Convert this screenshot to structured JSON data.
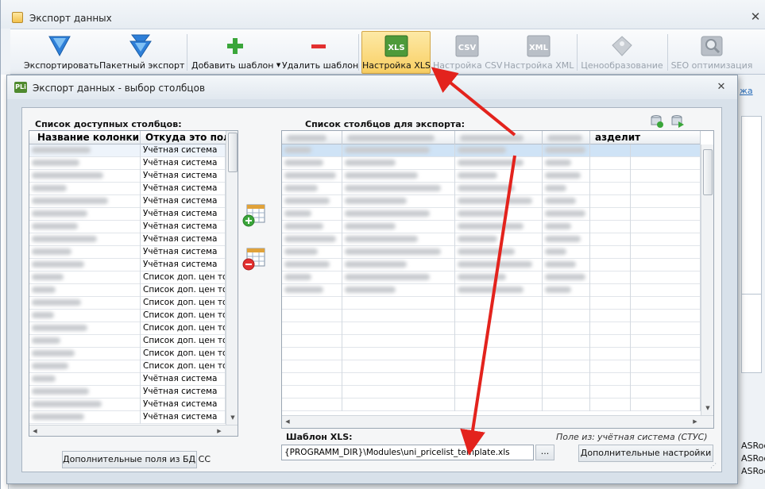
{
  "window": {
    "title": "Экспорт данных",
    "close_glyph": "✕"
  },
  "ribbon": {
    "buttons": [
      {
        "label": "Экспортировать",
        "icon": "export-down-arrow-icon"
      },
      {
        "label": "Пакетный экспорт",
        "icon": "batch-export-icon"
      },
      {
        "label": "Добавить шаблон",
        "icon": "plus-icon",
        "dropdown": "▼"
      },
      {
        "label": "Удалить шаблон",
        "icon": "minus-icon"
      },
      {
        "label": "Настройка XLS",
        "icon": "xls-icon",
        "icon_text": "XLS",
        "state": "active"
      },
      {
        "label": "Настройка CSV",
        "icon": "csv-icon",
        "icon_text": "CSV",
        "state": "disabled"
      },
      {
        "label": "Настройка XML",
        "icon": "xml-icon",
        "icon_text": "XML",
        "state": "disabled"
      },
      {
        "label": "Ценообразование",
        "icon": "pricing-icon",
        "state": "disabled"
      },
      {
        "label": "SEO оптимизация",
        "icon": "seo-icon",
        "state": "disabled"
      }
    ]
  },
  "background_right": {
    "link_fragment": "жа",
    "rows": [
      "ASRoc",
      "ASRoc",
      "ASRoc"
    ]
  },
  "dialog": {
    "title": "Экспорт данных - выбор столбцов",
    "app_icon_text": "PLi",
    "close_glyph": "✕",
    "available": {
      "label": "Список доступных столбцов:",
      "headers": [
        "Название колонки",
        "Откуда это поле"
      ],
      "rows": [
        "Учётная система",
        "Учётная система",
        "Учётная система",
        "Учётная система",
        "Учётная система",
        "Учётная система",
        "Учётная система",
        "Учётная система",
        "Учётная система",
        "Учётная система",
        "Список доп. цен то",
        "Список доп. цен то",
        "Список доп. цен то",
        "Список доп. цен то",
        "Список доп. цен то",
        "Список доп. цен то",
        "Список доп. цен то",
        "Список доп. цен то",
        "Учётная система",
        "Учётная система",
        "Учётная система",
        "Учётная система"
      ],
      "extra_button": "Дополнительные поля из БД СС"
    },
    "export": {
      "label": "Список столбцов для экспорта:",
      "headers": [
        "",
        "",
        "",
        "",
        "азделит"
      ]
    },
    "template": {
      "label": "Шаблон XLS:",
      "path": "{PROGRAMM_DIR}\\Modules\\uni_pricelist_template.xls",
      "browse": "...",
      "field_from_label": "Поле из:",
      "field_from_value": "учётная система (СТУС)",
      "more_settings": "Дополнительные настройки"
    }
  },
  "colors": {
    "accent_active": "#f9cf63",
    "selection_row": "#cfe3f6",
    "annotation_arrow": "#e3231d"
  }
}
